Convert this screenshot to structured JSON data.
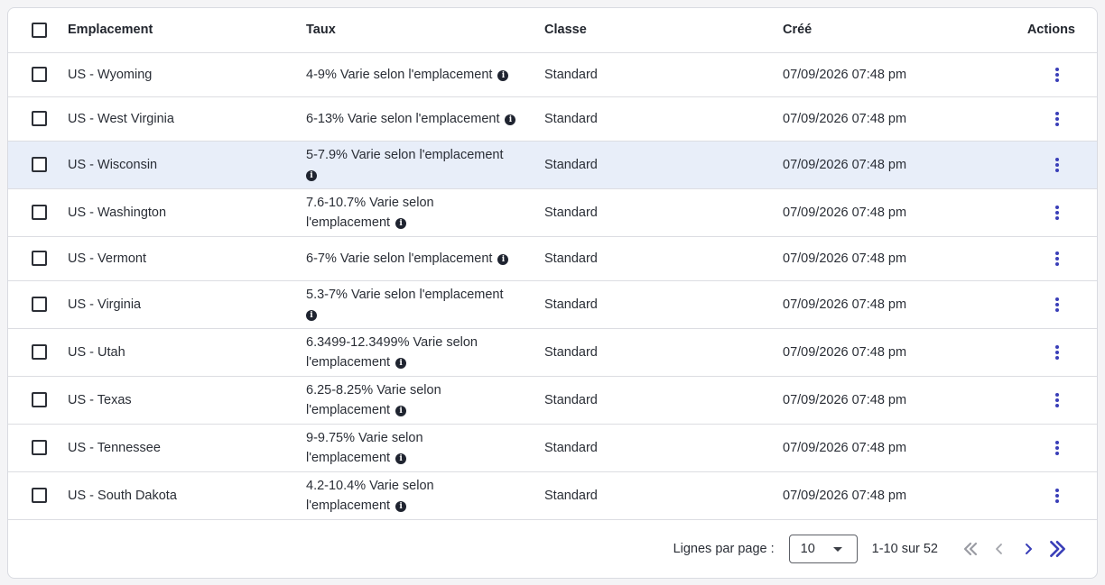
{
  "columns": {
    "location": "Emplacement",
    "rate": "Taux",
    "class": "Classe",
    "created": "Créé",
    "actions": "Actions"
  },
  "rows": [
    {
      "location": "US - Wyoming",
      "rate": "4-9% Varie selon l'emplacement",
      "class": "Standard",
      "created": "07/09/2026 07:48 pm"
    },
    {
      "location": "US - West Virginia",
      "rate": "6-13% Varie selon l'emplacement",
      "class": "Standard",
      "created": "07/09/2026 07:48 pm"
    },
    {
      "location": "US - Wisconsin",
      "rate": "5-7.9% Varie selon l'emplacement",
      "class": "Standard",
      "created": "07/09/2026 07:48 pm"
    },
    {
      "location": "US - Washington",
      "rate": "7.6-10.7% Varie selon l'emplacement",
      "class": "Standard",
      "created": "07/09/2026 07:48 pm"
    },
    {
      "location": "US - Vermont",
      "rate": "6-7% Varie selon l'emplacement",
      "class": "Standard",
      "created": "07/09/2026 07:48 pm"
    },
    {
      "location": "US - Virginia",
      "rate": "5.3-7% Varie selon l'emplacement",
      "class": "Standard",
      "created": "07/09/2026 07:48 pm"
    },
    {
      "location": "US - Utah",
      "rate": "6.3499-12.3499% Varie selon l'emplacement",
      "class": "Standard",
      "created": "07/09/2026 07:48 pm"
    },
    {
      "location": "US - Texas",
      "rate": "6.25-8.25% Varie selon l'emplacement",
      "class": "Standard",
      "created": "07/09/2026 07:48 pm"
    },
    {
      "location": "US - Tennessee",
      "rate": "9-9.75% Varie selon l'emplacement",
      "class": "Standard",
      "created": "07/09/2026 07:48 pm"
    },
    {
      "location": "US - South Dakota",
      "rate": "4.2-10.4% Varie selon l'emplacement",
      "class": "Standard",
      "created": "07/09/2026 07:48 pm"
    }
  ],
  "pagination": {
    "rows_per_page_label": "Lignes par page :",
    "rows_per_page_value": "10",
    "range_text": "1-10 sur 52"
  },
  "colors": {
    "accent": "#3a3fb8",
    "selected_row_bg": "#e8eef9",
    "border": "#dcdde2"
  },
  "icons": {
    "rate_info": "info-icon",
    "row_actions": "more-vertical-icon",
    "first_page": "chevron-double-left-icon",
    "prev_page": "chevron-left-icon",
    "next_page": "chevron-right-icon",
    "last_page": "chevron-double-right-icon"
  }
}
